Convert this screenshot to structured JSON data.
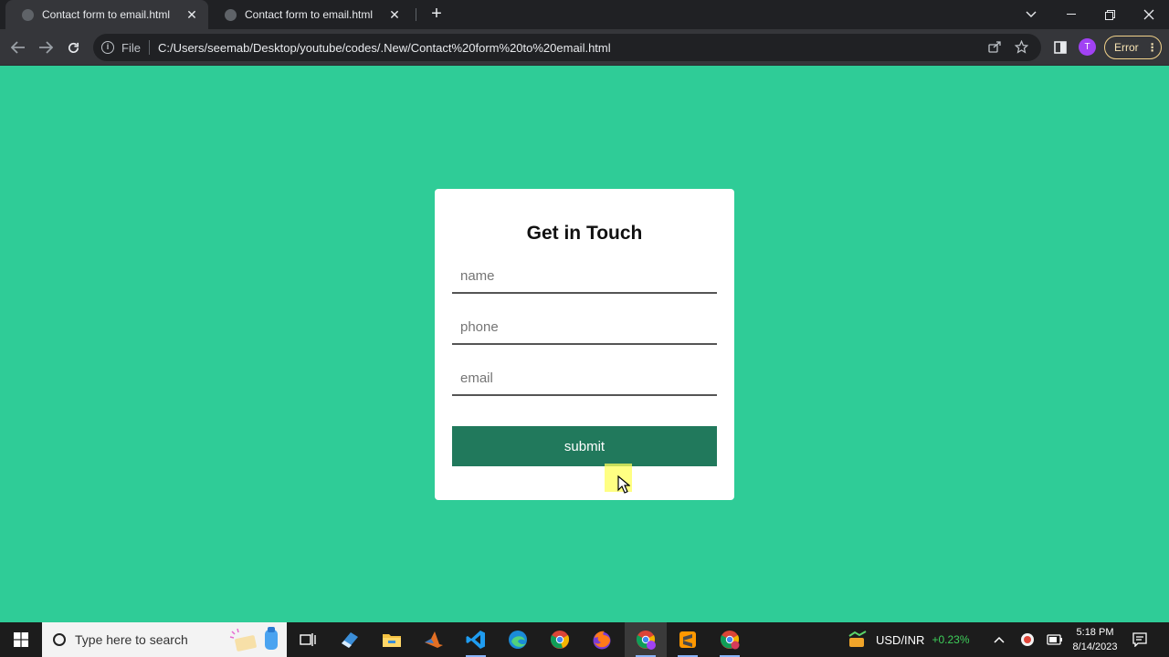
{
  "browser": {
    "tabs": [
      {
        "title": "Contact form to email.html",
        "active": true
      },
      {
        "title": "Contact form to email.html",
        "active": false
      }
    ],
    "new_tab": "+",
    "address": {
      "scheme_label": "File",
      "url": "C:/Users/seemab/Desktop/youtube/codes/.New/Contact%20form%20to%20email.html"
    },
    "profile_initial": "T",
    "error_label": "Error"
  },
  "form": {
    "title": "Get in Touch",
    "name_placeholder": "name",
    "phone_placeholder": "phone",
    "email_placeholder": "email",
    "submit_label": "submit"
  },
  "taskbar": {
    "search_placeholder": "Type here to search",
    "stock": {
      "label": "USD/INR",
      "change": "+0.23%",
      "change_color": "#3ecf5a"
    },
    "time": "5:18 PM",
    "date": "8/14/2023"
  },
  "colors": {
    "page_bg": "#2fcc97",
    "button_bg": "#21795c",
    "card_bg": "#ffffff"
  }
}
